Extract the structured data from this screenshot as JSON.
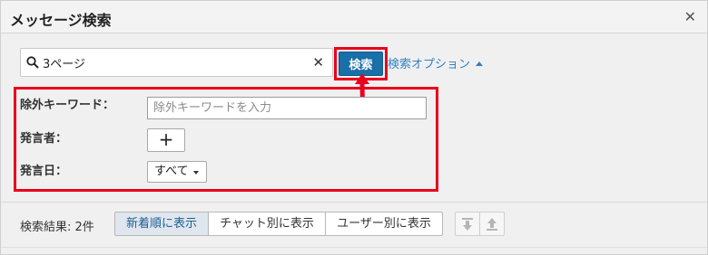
{
  "dialog": {
    "title": "メッセージ検索",
    "close_icon": "close-icon"
  },
  "search": {
    "value": "3ページ",
    "icon": "search-icon",
    "button_label": "検索",
    "options_link": "検索オプション"
  },
  "options": {
    "exclude_label": "除外キーワード：",
    "exclude_placeholder": "除外キーワードを入力",
    "sender_label": "発言者：",
    "add_sender": "+",
    "date_label": "発言日：",
    "date_value": "すべて"
  },
  "results": {
    "label": "検索結果: 2件",
    "tabs": [
      {
        "label": "新着順に表示",
        "active": true
      },
      {
        "label": "チャット別に表示",
        "active": false
      },
      {
        "label": "ユーザー別に表示",
        "active": false
      }
    ],
    "icons": [
      "expand-down-icon",
      "collapse-up-icon"
    ]
  },
  "colors": {
    "highlight": "#e8001c",
    "primary_button": "#1a6fa8",
    "link": "#2f80c3"
  }
}
